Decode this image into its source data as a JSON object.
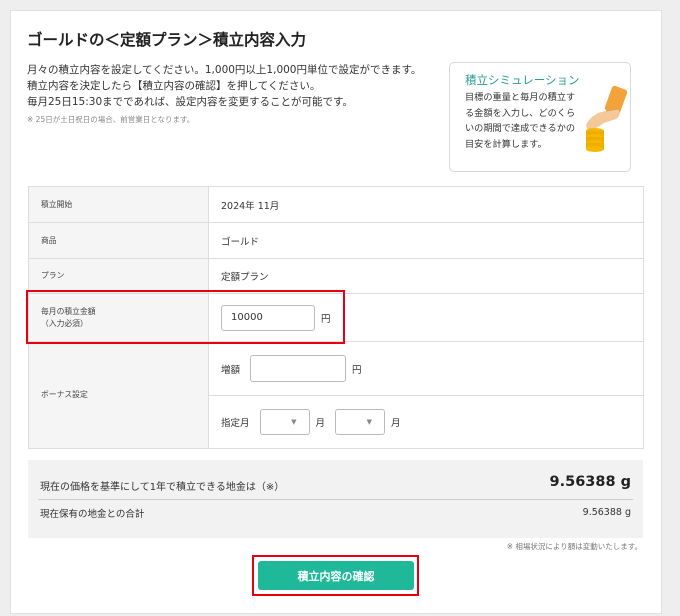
{
  "page": {
    "title": "ゴールドの＜定額プラン＞積立内容入力",
    "intro": [
      "月々の積立内容を設定してください。1,000円以上1,000円単位で設定ができます。",
      "積立内容を決定したら【積立内容の確認】を押してください。",
      "毎月25日15:30までであれば、設定内容を変更することが可能です。"
    ],
    "small_note": "※ 25日が土日祝日の場合、前営業日となります。"
  },
  "simulation": {
    "title": "積立シミュレーション",
    "text": "目標の重量と毎月の積立する金額を入力し、どのくらいの期間で達成できるかの目安を計算します。",
    "illustration_icon": "hand-holding-gold-coins-icon"
  },
  "form": {
    "start": {
      "label": "積立開始",
      "value": "2024年 11月"
    },
    "product": {
      "label": "商品",
      "value": "ゴールド"
    },
    "plan": {
      "label": "プラン",
      "value": "定額プラン"
    },
    "monthly": {
      "label": "毎月の積立金額",
      "label_sub": "（入力必須）",
      "value": "10000",
      "unit": "円"
    },
    "bonus": {
      "label": "ボーナス設定",
      "increase_label": "増額",
      "increase_value": "",
      "increase_unit": "円",
      "month_label": "指定月",
      "month1_value": "",
      "month1_unit": "月",
      "month2_value": "",
      "month2_unit": "月"
    }
  },
  "summary": {
    "line1_label": "現在の価格を基準にして1年で積立できる地金は（※）",
    "line1_value": "9.56388 g",
    "line2_label": "現在保有の地金との合計",
    "line2_value": "9.56388 g",
    "footnote": "※ 相場状況により額は変動いたします。"
  },
  "actions": {
    "confirm_label": "積立内容の確認"
  },
  "colors": {
    "accent": "#1fb99a",
    "highlight": "#e60012",
    "sim_title": "#2a9d8f"
  }
}
